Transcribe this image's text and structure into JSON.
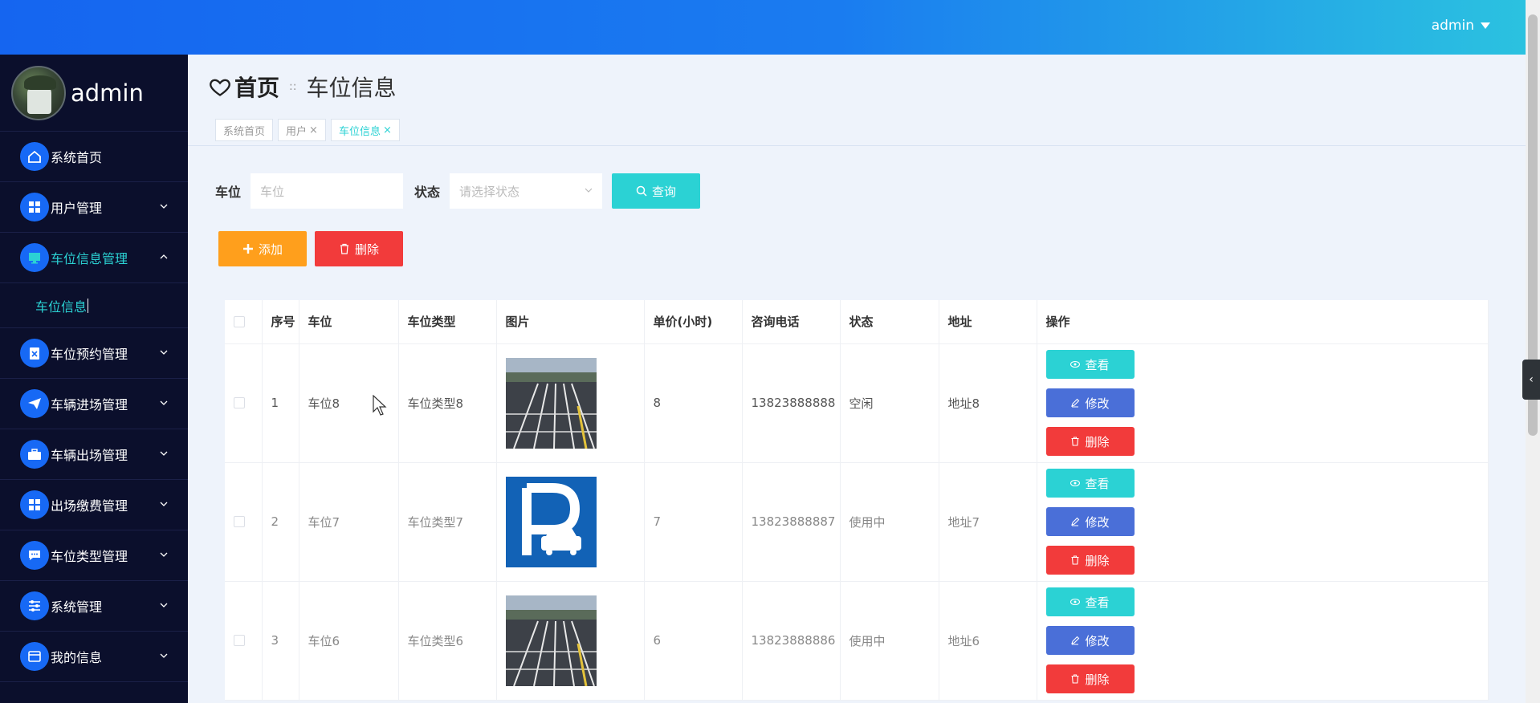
{
  "topbar": {
    "user": "admin"
  },
  "sidebar": {
    "profile_name": "admin",
    "items": [
      {
        "label": "系统首页",
        "icon": "home-icon",
        "chevron": ""
      },
      {
        "label": "用户管理",
        "icon": "grid-icon",
        "chevron": "down"
      },
      {
        "label": "车位信息管理",
        "icon": "monitor-icon",
        "chevron": "up",
        "active": true
      },
      {
        "label": "车位预约管理",
        "icon": "clipboard-icon",
        "chevron": "down"
      },
      {
        "label": "车辆进场管理",
        "icon": "send-icon",
        "chevron": "down"
      },
      {
        "label": "车辆出场管理",
        "icon": "briefcase-icon",
        "chevron": "down"
      },
      {
        "label": "出场缴费管理",
        "icon": "grid-icon",
        "chevron": "down"
      },
      {
        "label": "车位类型管理",
        "icon": "chat-icon",
        "chevron": "down"
      },
      {
        "label": "系统管理",
        "icon": "sliders-icon",
        "chevron": "down"
      },
      {
        "label": "我的信息",
        "icon": "card-icon",
        "chevron": "down"
      }
    ],
    "submenu": {
      "label": "车位信息"
    }
  },
  "header": {
    "home": "首页",
    "separator": "::",
    "current": "车位信息",
    "tags": [
      {
        "label": "系统首页",
        "closable": false
      },
      {
        "label": "用户",
        "closable": true
      },
      {
        "label": "车位信息",
        "closable": true,
        "active": true
      }
    ],
    "close_glyph": "×"
  },
  "search": {
    "space_label": "车位",
    "space_placeholder": "车位",
    "status_label": "状态",
    "status_placeholder": "请选择状态",
    "query_button": "查询"
  },
  "actions": {
    "add": "添加",
    "delete": "删除"
  },
  "table": {
    "columns": [
      "序号",
      "车位",
      "车位类型",
      "图片",
      "单价(小时)",
      "咨询电话",
      "状态",
      "地址",
      "操作"
    ],
    "rows": [
      {
        "index": "1",
        "space": "车位8",
        "type": "车位类型8",
        "image": "parking-lot-photo",
        "price": "8",
        "phone": "13823888888",
        "status": "空闲",
        "address": "地址8"
      },
      {
        "index": "2",
        "space": "车位7",
        "type": "车位类型7",
        "image": "parking-sign-icon",
        "price": "7",
        "phone": "13823888887",
        "status": "使用中",
        "address": "地址7"
      },
      {
        "index": "3",
        "space": "车位6",
        "type": "车位类型6",
        "image": "parking-lot-photo",
        "price": "6",
        "phone": "13823888886",
        "status": "使用中",
        "address": "地址6"
      }
    ],
    "ops": {
      "view": "查看",
      "edit": "修改",
      "delete": "删除"
    }
  },
  "colors": {
    "accent": "#2bd2d4",
    "primary": "#1769f5",
    "warning": "#ff9f1c",
    "danger": "#f23b3b",
    "edit": "#4a6fd8",
    "sidebar_bg": "#0b0f2c"
  }
}
